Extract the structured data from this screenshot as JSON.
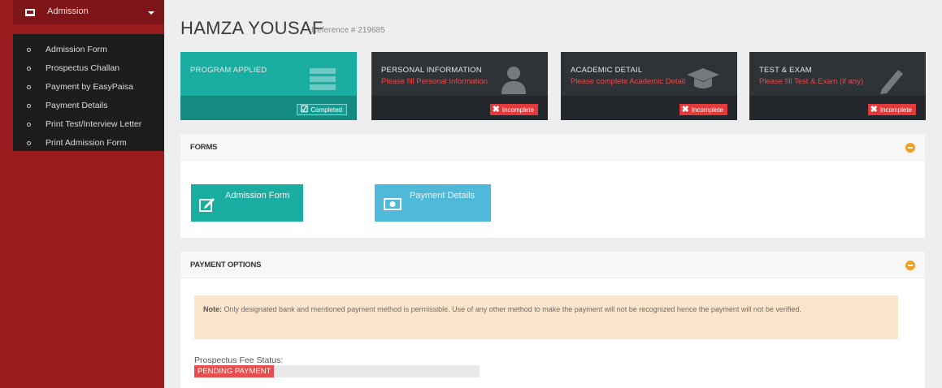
{
  "sidebar": {
    "section_label": "Admission",
    "items": [
      {
        "label": "Admission Form"
      },
      {
        "label": "Prospectus Challan"
      },
      {
        "label": "Payment by EasyPaisa"
      },
      {
        "label": "Payment Details"
      },
      {
        "label": "Print Test/Interview Letter"
      },
      {
        "label": "Print Admission Form"
      }
    ]
  },
  "header": {
    "name": "HAMZA YOUSAF",
    "reference": "Reference # 219685"
  },
  "tiles": [
    {
      "title": "PROGRAM APPLIED",
      "subtitle": "",
      "status": "Completed",
      "icon": "list-icon"
    },
    {
      "title": "PERSONAL INFORMATION",
      "subtitle": "Please fill Personal Information",
      "status": "Incomplete",
      "icon": "user-icon"
    },
    {
      "title": "ACADEMIC DETAIL",
      "subtitle": "Please complete Academic Detail",
      "status": "Incomplete",
      "icon": "graduation-cap-icon"
    },
    {
      "title": "TEST & EXAM",
      "subtitle": "Please fill Test & Exam (if any)",
      "status": "Incomplete",
      "icon": "pencil-icon"
    }
  ],
  "forms_panel": {
    "title": "FORMS",
    "buttons": [
      {
        "label": "Admission Form",
        "color": "#1aaea3",
        "icon": "edit-icon"
      },
      {
        "label": "Payment Details",
        "color": "#4fb9da",
        "icon": "money-icon"
      }
    ]
  },
  "payment_panel": {
    "title": "PAYMENT OPTIONS",
    "note_prefix": "Note:",
    "note_text": "Only designated bank and mentioned payment method is permissible. Use of any other method to make the payment will not be recognized hence the payment will not be verified.",
    "fee_status_label": "Prospectus Fee Status:",
    "fee_status_value": "PENDING PAYMENT"
  },
  "colors": {
    "sidebar_bg": "#9b1c1f",
    "tile_dark": "#2e3338",
    "tile_green": "#1aaea3",
    "danger": "#e23a3a",
    "warning_bg": "#fbe6cd",
    "toggle": "#f0a020"
  }
}
